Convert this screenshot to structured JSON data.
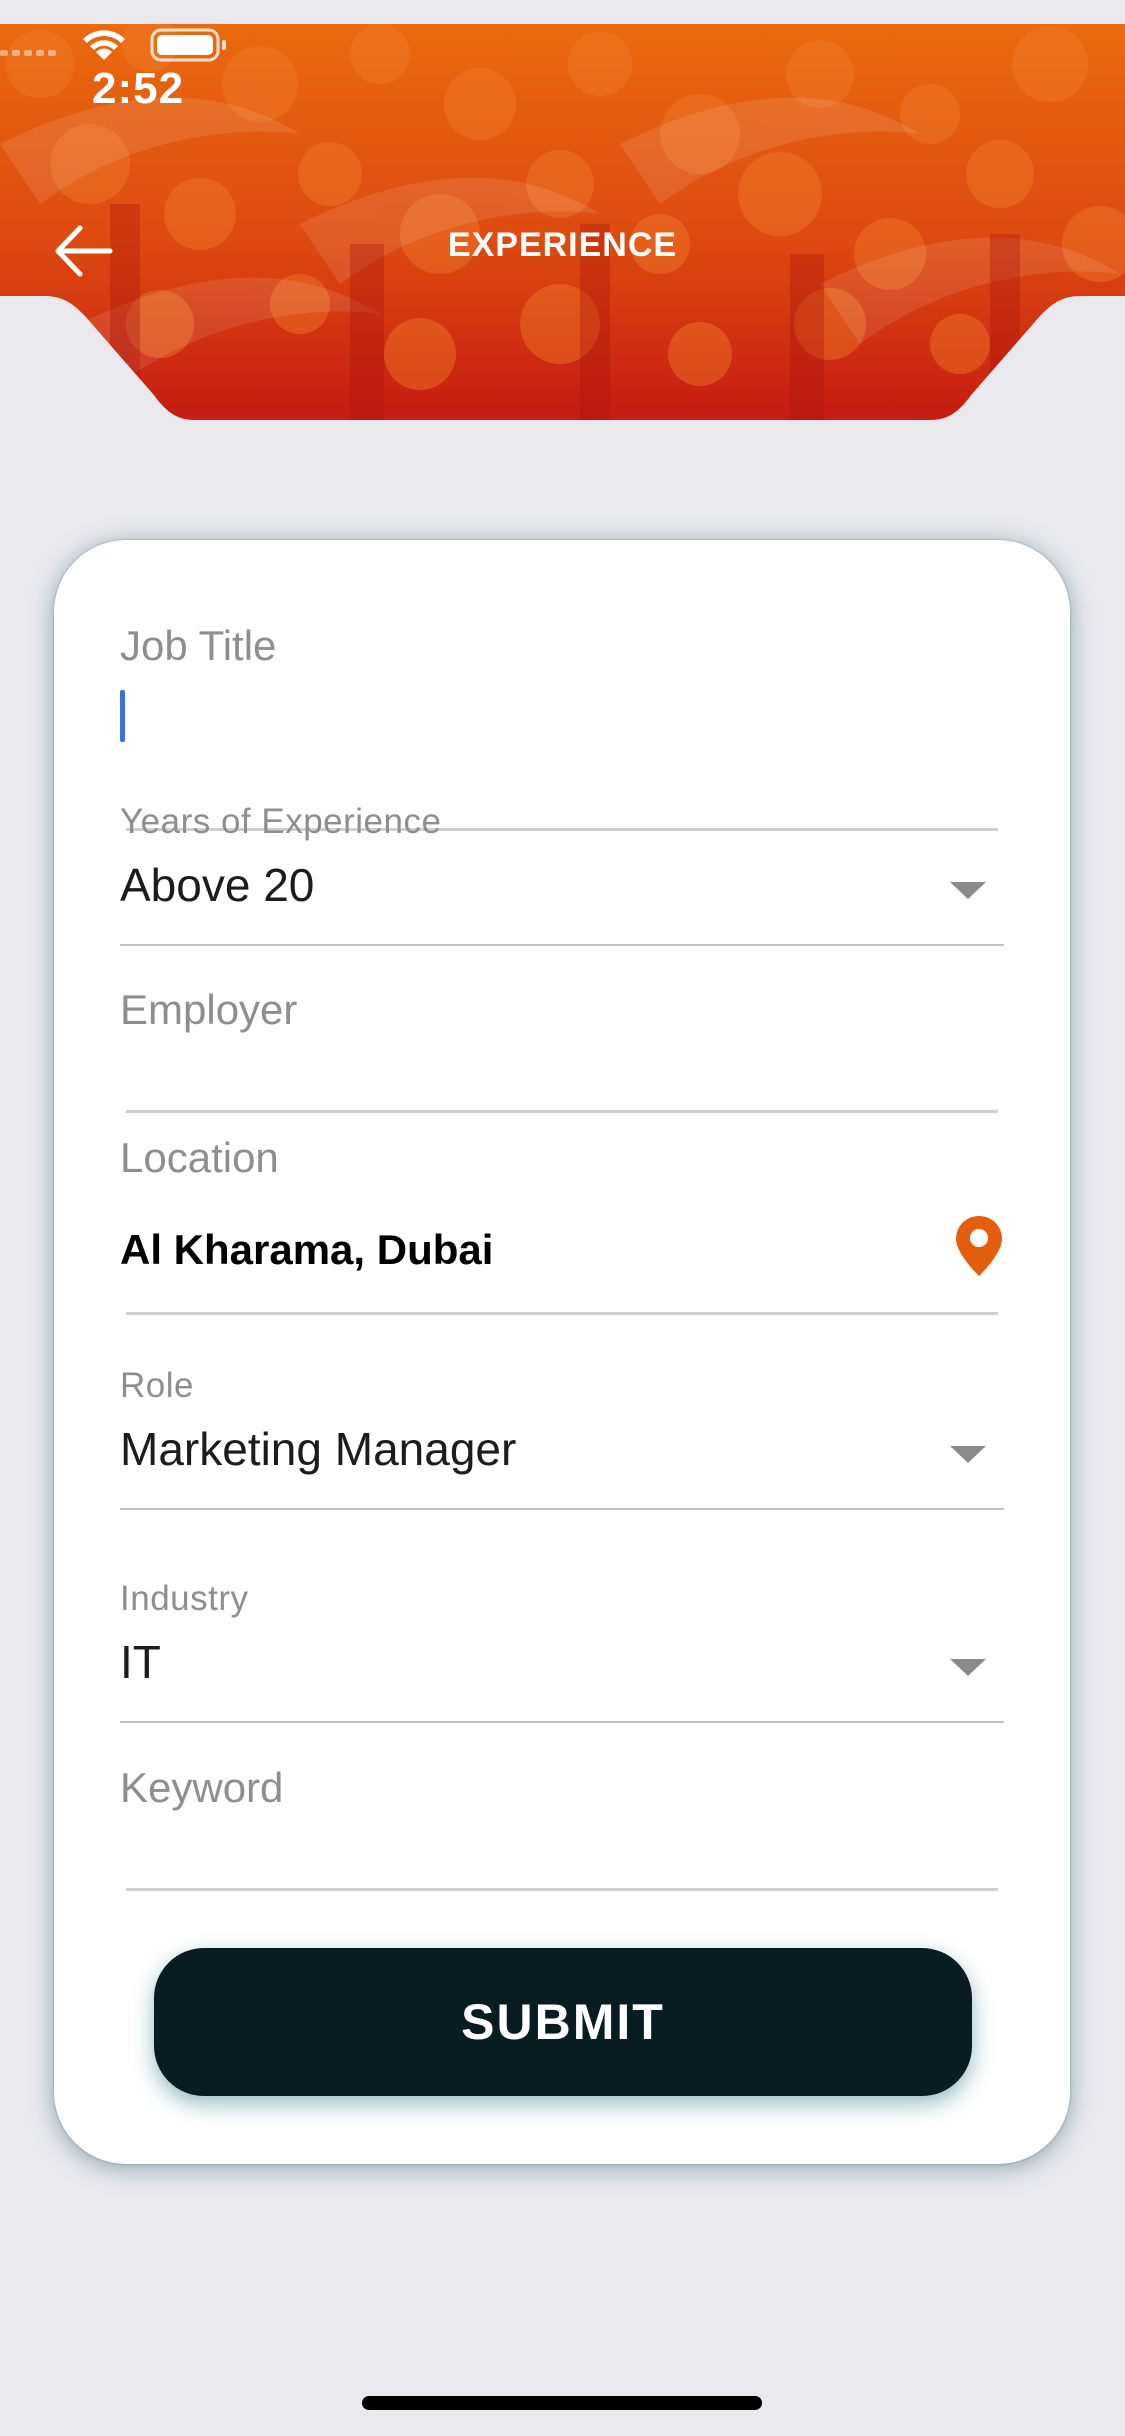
{
  "status_bar": {
    "time": "2:52"
  },
  "header": {
    "title": "EXPERIENCE",
    "accent_colors": [
      "#e8640c",
      "#c81e14"
    ]
  },
  "form": {
    "job_title": {
      "label": "Job Title",
      "value": ""
    },
    "years_of_experience": {
      "label": "Years of Experience",
      "value": "Above 20"
    },
    "employer": {
      "label": "Employer",
      "value": ""
    },
    "location": {
      "label": "Location",
      "value": "Al Kharama, Dubai",
      "icon": "location-pin-icon",
      "icon_color": "#e35f0f"
    },
    "role": {
      "label": "Role",
      "value": "Marketing Manager"
    },
    "industry": {
      "label": "Industry",
      "value": "IT"
    },
    "keyword": {
      "label": "Keyword",
      "value": ""
    }
  },
  "submit_label": "SUBMIT"
}
